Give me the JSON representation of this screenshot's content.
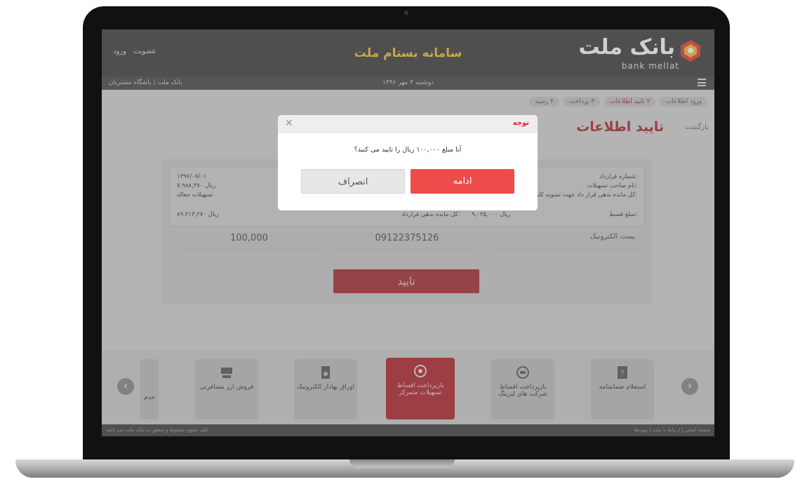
{
  "header": {
    "logo_fa": "بانک ملت",
    "logo_en": "bank mellat",
    "portal_title": "سامانه بستام ملت",
    "login": "ورود",
    "register": "عضویت"
  },
  "subbar": {
    "date": "دوشنبه ۳ مهر ۱۳۹۶",
    "breadcrumb": "بانک ملت | باشگاه مشتریان"
  },
  "steps": [
    {
      "label": "ورود اطلاعات"
    },
    {
      "label": "۲ تایید اطلاعات"
    },
    {
      "label": "۳ پرداخت"
    },
    {
      "label": "۴ رسید"
    }
  ],
  "page": {
    "back": "بازگشت",
    "title": "تایید اطلاعات"
  },
  "info": {
    "right_labels": [
      "شماره قرارداد:",
      "نام صاحب تسهیلات:",
      "کل مانده بدهی قرار داد جهت تسویه کلی:",
      "مبلغ قسط:"
    ],
    "left_values": [
      "۱۳۹۶/۰۷/۰۱",
      "۷,۹۸۸,۳۷۰ ریال",
      "تسهیلات جعاله",
      "۸۹,۲۱۳,۲۷۰ ریال"
    ],
    "mid_label": "کل مانده بدهی قرارداد:",
    "mid_value": "۹,۰۲۵,۰۰۰ ریال"
  },
  "form": {
    "amount_value": "100,000",
    "mobile_value": "09122375126",
    "email_label": "پست الکترونیک",
    "confirm_label": "تایید"
  },
  "services": {
    "cards": [
      {
        "label": "استعلام ضمانتنامه"
      },
      {
        "label": "بازپرداخت اقساط شرکت های لیزینگ"
      },
      {
        "label": "بازپرداخت اقساط تسهیلات متمرکز"
      },
      {
        "label": "اوراق بهادار الکترونیک"
      },
      {
        "label": "فروش ارز مسافرتی"
      },
      {
        "label": "خدم"
      }
    ]
  },
  "footer": {
    "left": "کلیه حقوق محفوظ و متعلق به بانک ملت می باشد",
    "right": "صفحه اصلی | ارتباط با ملت | پیوندها"
  },
  "modal": {
    "title": "توجه",
    "message": "آیا مبلغ ۱۰۰,۰۰۰ ریال را تایید می کنید؟",
    "continue": "ادامه",
    "cancel": "انصراف"
  },
  "colors": {
    "brand_red": "#b01f25",
    "accent_red": "#ee4b4b",
    "gold": "#f1c232"
  }
}
